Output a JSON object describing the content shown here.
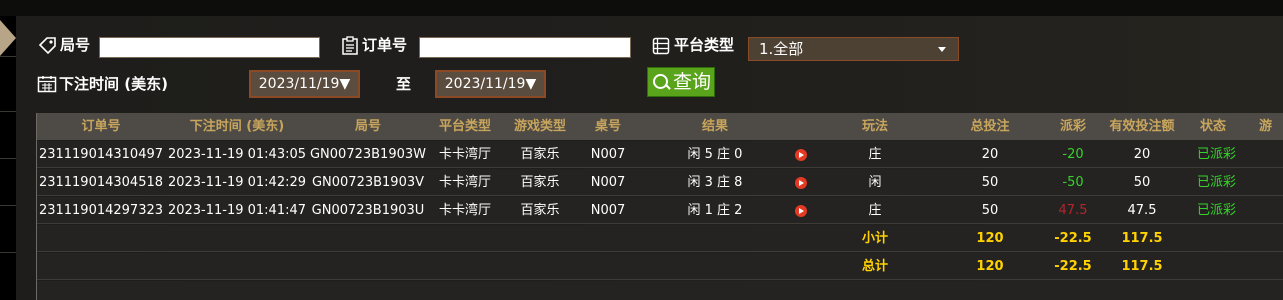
{
  "filters": {
    "round_label": "局号",
    "round_value": "",
    "order_label": "订单号",
    "order_value": "",
    "platform_label": "平台类型",
    "platform_selected": "1.全部",
    "time_label": "下注时间 (美东)",
    "date_from": "2023/11/19▼",
    "to_label": "至",
    "date_to": "2023/11/19▼",
    "search_label": "查询"
  },
  "table": {
    "headers": [
      "订单号",
      "下注时间 (美东)",
      "局号",
      "平台类型",
      "游戏类型",
      "桌号",
      "结果",
      "",
      "玩法",
      "总投注",
      "派彩",
      "有效投注额",
      "状态",
      "游"
    ],
    "rows": [
      {
        "order": "231119014310497",
        "time": "2023-11-19 01:43:05",
        "round": "GN00723B1903W",
        "platform": "卡卡湾厅",
        "game": "百家乐",
        "table": "N007",
        "result": "闲 5 庄 0",
        "play": "庄",
        "bet": "20",
        "payout": "-20",
        "valid": "20",
        "status": "已派彩"
      },
      {
        "order": "231119014304518",
        "time": "2023-11-19 01:42:29",
        "round": "GN00723B1903V",
        "platform": "卡卡湾厅",
        "game": "百家乐",
        "table": "N007",
        "result": "闲 3 庄 8",
        "play": "闲",
        "bet": "50",
        "payout": "-50",
        "valid": "50",
        "status": "已派彩"
      },
      {
        "order": "231119014297323",
        "time": "2023-11-19 01:41:47",
        "round": "GN00723B1903U",
        "platform": "卡卡湾厅",
        "game": "百家乐",
        "table": "N007",
        "result": "闲 1 庄 2",
        "play": "庄",
        "bet": "50",
        "payout": "47.5",
        "valid": "47.5",
        "status": "已派彩"
      }
    ],
    "subtotal": {
      "label": "小计",
      "bet": "120",
      "payout": "-22.5",
      "valid": "117.5"
    },
    "total": {
      "label": "总计",
      "bet": "120",
      "payout": "-22.5",
      "valid": "117.5"
    }
  },
  "colors": {
    "accent": "#c8a55c",
    "sum": "#ffd200",
    "positive": "#34d32b",
    "negative": "#b3262a",
    "button": "#5aa41c"
  }
}
